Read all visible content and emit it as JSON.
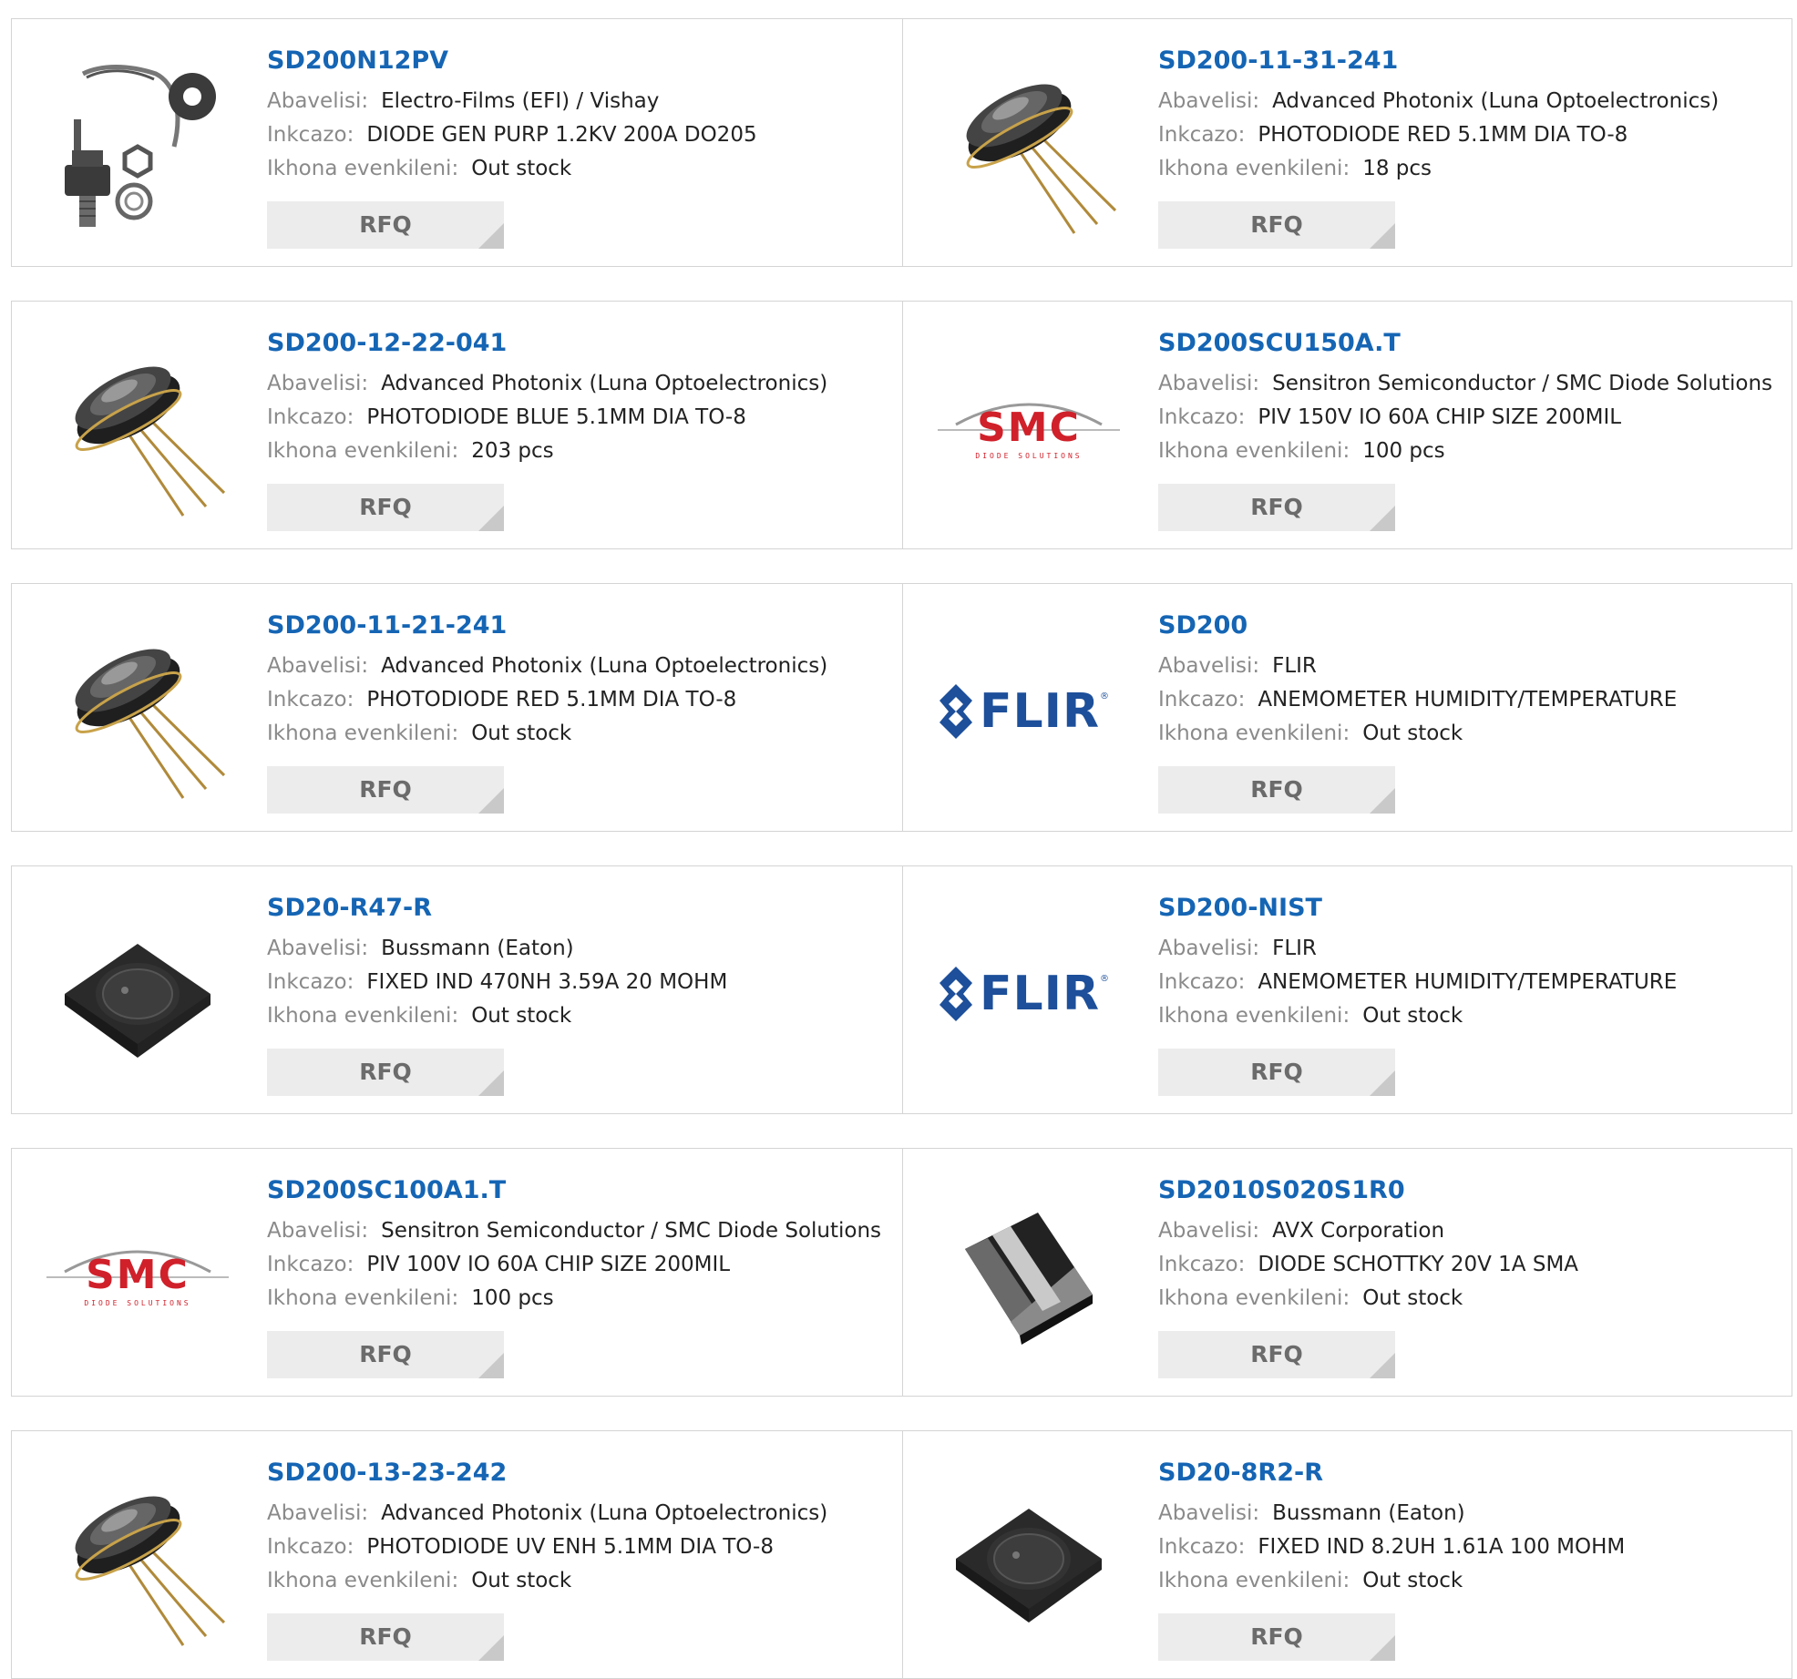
{
  "labels": {
    "manufacturer": "Abavelisi:",
    "description": "Inkcazo:",
    "stock": "Ikhona evenkileni:",
    "rfq": "RFQ"
  },
  "products": [
    {
      "part": "SD200N12PV",
      "manufacturer": "Electro-Films (EFI) / Vishay",
      "description": "DIODE GEN PURP 1.2KV 200A DO205",
      "stock": "Out stock",
      "image": "stud-diode-icon"
    },
    {
      "part": "SD200-11-31-241",
      "manufacturer": "Advanced Photonix (Luna Optoelectronics)",
      "description": "PHOTODIODE RED 5.1MM DIA TO-8",
      "stock": "18 pcs",
      "image": "to8-photodiode-icon"
    },
    {
      "part": "SD200-12-22-041",
      "manufacturer": "Advanced Photonix (Luna Optoelectronics)",
      "description": "PHOTODIODE BLUE 5.1MM DIA TO-8",
      "stock": "203 pcs",
      "image": "to8-photodiode-icon"
    },
    {
      "part": "SD200SCU150A.T",
      "manufacturer": "Sensitron Semiconductor / SMC Diode Solutions",
      "description": "PIV 150V IO 60A CHIP SIZE 200MIL",
      "stock": "100 pcs",
      "image": "smc-logo"
    },
    {
      "part": "SD200-11-21-241",
      "manufacturer": "Advanced Photonix (Luna Optoelectronics)",
      "description": "PHOTODIODE RED 5.1MM DIA TO-8",
      "stock": "Out stock",
      "image": "to8-photodiode-icon"
    },
    {
      "part": "SD200",
      "manufacturer": "FLIR",
      "description": "ANEMOMETER HUMIDITY/TEMPERATURE",
      "stock": "Out stock",
      "image": "flir-logo"
    },
    {
      "part": "SD20-R47-R",
      "manufacturer": "Bussmann (Eaton)",
      "description": "FIXED IND 470NH 3.59A 20 MOHM",
      "stock": "Out stock",
      "image": "smd-inductor-icon"
    },
    {
      "part": "SD200-NIST",
      "manufacturer": "FLIR",
      "description": "ANEMOMETER HUMIDITY/TEMPERATURE",
      "stock": "Out stock",
      "image": "flir-logo"
    },
    {
      "part": "SD200SC100A1.T",
      "manufacturer": "Sensitron Semiconductor / SMC Diode Solutions",
      "description": "PIV 100V IO 60A CHIP SIZE 200MIL",
      "stock": "100 pcs",
      "image": "smc-logo"
    },
    {
      "part": "SD2010S020S1R0",
      "manufacturer": "AVX Corporation",
      "description": "DIODE SCHOTTKY 20V 1A SMA",
      "stock": "Out stock",
      "image": "sma-diode-icon"
    },
    {
      "part": "SD200-13-23-242",
      "manufacturer": "Advanced Photonix (Luna Optoelectronics)",
      "description": "PHOTODIODE UV ENH 5.1MM DIA TO-8",
      "stock": "Out stock",
      "image": "to8-photodiode-icon"
    },
    {
      "part": "SD20-8R2-R",
      "manufacturer": "Bussmann (Eaton)",
      "description": "FIXED IND 8.2UH 1.61A 100 MOHM",
      "stock": "Out stock",
      "image": "smd-inductor-icon"
    }
  ],
  "logos": {
    "smc": {
      "text": "SMC",
      "subtext": "DIODE SOLUTIONS",
      "color": "#d0202a"
    },
    "flir": {
      "text": "FLIR",
      "mark": "®",
      "color": "#1d4f9a"
    }
  },
  "colors": {
    "link": "#1565b4",
    "label": "#8a8a8a",
    "button_bg": "#ececec"
  }
}
